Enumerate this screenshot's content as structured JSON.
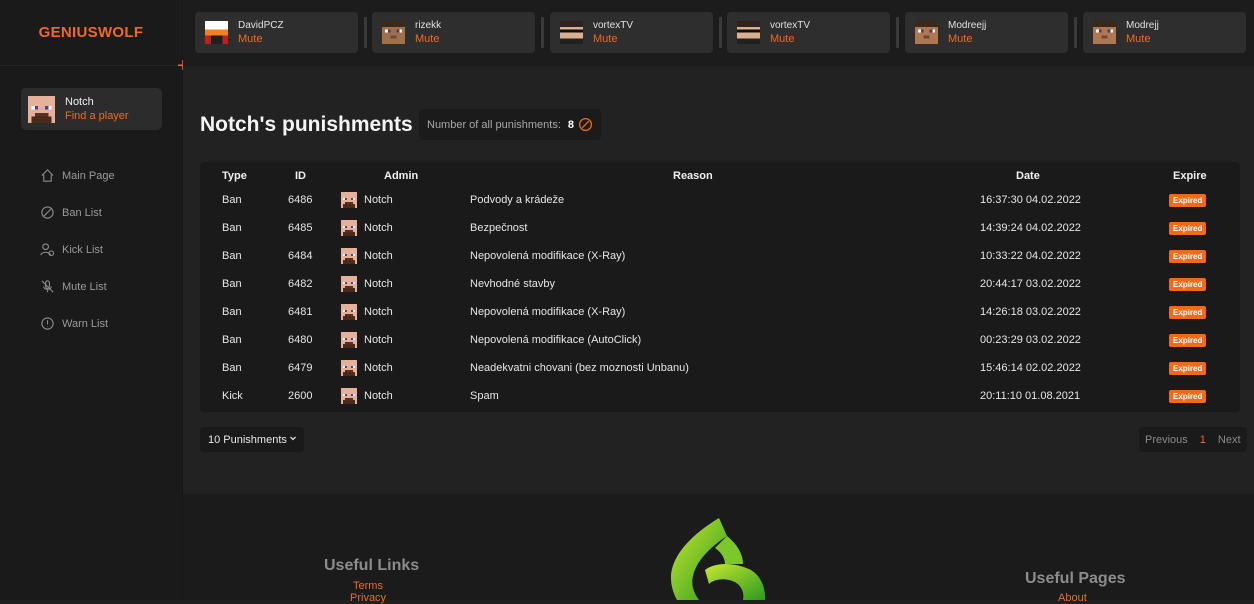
{
  "brand": {
    "logo_text": "GENIUSWOLF",
    "accent": "#f06a1e"
  },
  "profile": {
    "name": "Notch",
    "action": "Find a player"
  },
  "nav": [
    {
      "label": "Main Page",
      "icon": "home-icon"
    },
    {
      "label": "Ban List",
      "icon": "ban-icon"
    },
    {
      "label": "Kick List",
      "icon": "kick-user-icon"
    },
    {
      "label": "Mute List",
      "icon": "mute-mic-icon"
    },
    {
      "label": "Warn List",
      "icon": "warning-icon"
    }
  ],
  "recent_players": [
    {
      "name": "DavidPCZ",
      "action": "Mute"
    },
    {
      "name": "rizekk",
      "action": "Mute"
    },
    {
      "name": "vortexTV",
      "action": "Mute"
    },
    {
      "name": "vortexTV",
      "action": "Mute"
    },
    {
      "name": "Modreejj",
      "action": "Mute"
    },
    {
      "name": "Modrejj",
      "action": "Mute"
    }
  ],
  "page": {
    "title": "Notch's punishments",
    "count_label": "Number of all punishments:",
    "count_value": "8"
  },
  "table": {
    "headers": [
      "Type",
      "ID",
      "Admin",
      "Reason",
      "Date",
      "Expire"
    ],
    "rows": [
      {
        "type": "Ban",
        "id": "6486",
        "admin": "Notch",
        "reason": "Podvody a krádeže",
        "date": "16:37:30 04.02.2022",
        "expire": "Expired"
      },
      {
        "type": "Ban",
        "id": "6485",
        "admin": "Notch",
        "reason": "Bezpečnost",
        "date": "14:39:24 04.02.2022",
        "expire": "Expired"
      },
      {
        "type": "Ban",
        "id": "6484",
        "admin": "Notch",
        "reason": "Nepovolená modifikace (X-Ray)",
        "date": "10:33:22 04.02.2022",
        "expire": "Expired"
      },
      {
        "type": "Ban",
        "id": "6482",
        "admin": "Notch",
        "reason": "Nevhodné stavby",
        "date": "20:44:17 03.02.2022",
        "expire": "Expired"
      },
      {
        "type": "Ban",
        "id": "6481",
        "admin": "Notch",
        "reason": "Nepovolená modifikace (X-Ray)",
        "date": "14:26:18 03.02.2022",
        "expire": "Expired"
      },
      {
        "type": "Ban",
        "id": "6480",
        "admin": "Notch",
        "reason": "Nepovolená modifikace (AutoClick)",
        "date": "00:23:29 03.02.2022",
        "expire": "Expired"
      },
      {
        "type": "Ban",
        "id": "6479",
        "admin": "Notch",
        "reason": "Neadekvatni chovani (bez moznosti Unbanu)",
        "date": "15:46:14 02.02.2022",
        "expire": "Expired"
      },
      {
        "type": "Kick",
        "id": "2600",
        "admin": "Notch",
        "reason": "Spam",
        "date": "20:11:10 01.08.2021",
        "expire": "Expired"
      }
    ]
  },
  "pagination": {
    "per_page": "10 Punishments",
    "previous": "Previous",
    "current": "1",
    "next": "Next"
  },
  "footer": {
    "useful_links_title": "Useful Links",
    "links": [
      "Terms",
      "Privacy"
    ],
    "useful_pages_title": "Useful Pages",
    "pages": [
      "About"
    ]
  }
}
